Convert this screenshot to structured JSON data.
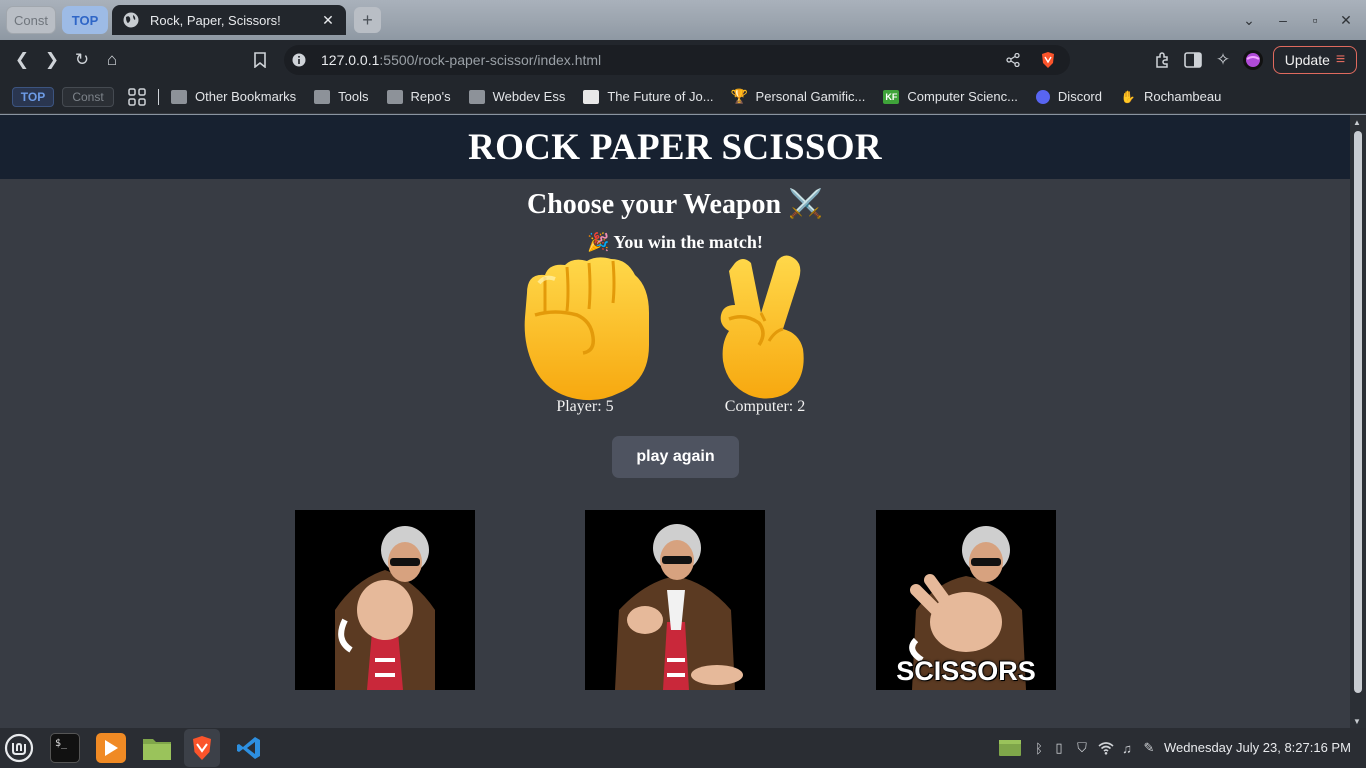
{
  "browser": {
    "tab_groups": [
      "Const",
      "TOP"
    ],
    "active_tab_title": "Rock, Paper, Scissors!",
    "url_host": "127.0.0.1",
    "url_rest": ":5500/rock-paper-scissor/index.html",
    "update_label": "Update",
    "bookmarks": {
      "group_top": "TOP",
      "group_const": "Const",
      "items": [
        "Other Bookmarks",
        "Tools",
        "Repo's",
        "Webdev Ess",
        "The Future of Jo...",
        "Personal Gamific...",
        "Computer Scienc...",
        "Discord",
        "Rochambeau"
      ]
    }
  },
  "page": {
    "header_title": "ROCK PAPER SCISSOR",
    "subtitle": "Choose your Weapon ⚔️",
    "result": "🎉 You win the match!",
    "player_choice_icon": "raised-fist-emoji",
    "computer_choice_icon": "victory-hand-emoji",
    "player_score": "Player: 5",
    "computer_score": "Computer: 2",
    "play_again_label": "play again",
    "weapons": [
      {
        "name": "rock",
        "label": ""
      },
      {
        "name": "paper",
        "label": ""
      },
      {
        "name": "scissors",
        "label": "SCISSORS"
      }
    ]
  },
  "taskbar": {
    "clock": "Wednesday July 23,  8:27:16 PM"
  },
  "colors": {
    "page_bg": "#383c44",
    "header_bg": "#172130",
    "button_bg": "#4e5360",
    "emoji_yellow": "#ffca28",
    "accent_update": "#e06a5e"
  }
}
